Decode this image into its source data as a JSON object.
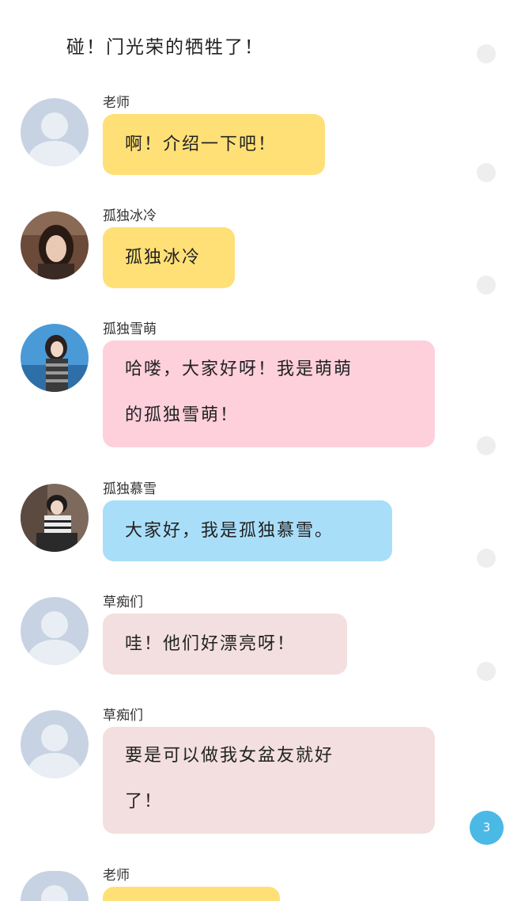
{
  "header": {
    "top_message": "碰！门光荣的牺牲了！"
  },
  "messages": [
    {
      "sender": "老师",
      "text": "啊！介绍一下吧！",
      "bubble_color": "#ffe077",
      "avatar": "default-avatar"
    },
    {
      "sender": "孤独冰冷",
      "text": "孤独冰冷",
      "bubble_color": "#ffe077",
      "avatar": "user-photo-avatar"
    },
    {
      "sender": "孤独雪萌",
      "text_line1": "哈喽，大家好呀！我是萌萌",
      "text_line2": "的孤独雪萌！",
      "bubble_color": "#fdd0dc",
      "avatar": "user-photo-avatar"
    },
    {
      "sender": "孤独慕雪",
      "text": "大家好，我是孤独慕雪。",
      "bubble_color": "#a9def9",
      "avatar": "user-photo-avatar"
    },
    {
      "sender": "草痴们",
      "text": "哇！他们好漂亮呀！",
      "bubble_color": "#f3dfdf",
      "avatar": "default-avatar"
    },
    {
      "sender": "草痴们",
      "text_line1": "要是可以做我女盆友就好",
      "text_line2": "了！",
      "bubble_color": "#f3dfdf",
      "avatar": "default-avatar"
    },
    {
      "sender": "老师",
      "text": "",
      "bubble_color": "#ffe077",
      "avatar": "default-avatar"
    }
  ],
  "unread_badge": {
    "count": "3",
    "color": "#4bb9e6"
  }
}
